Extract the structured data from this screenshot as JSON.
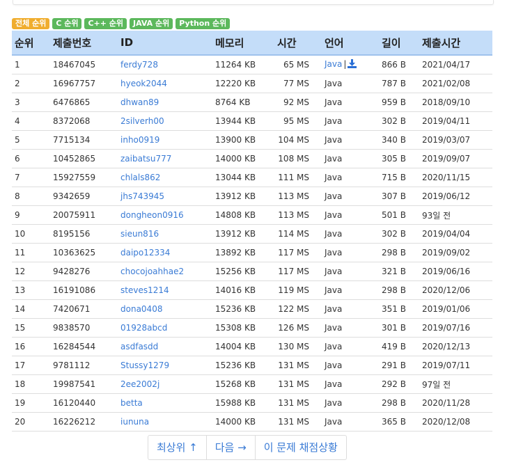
{
  "filters": [
    {
      "label": "전체 순위",
      "color": "#f0ad2e"
    },
    {
      "label": "C 순위",
      "color": "#5cb85c"
    },
    {
      "label": "C++ 순위",
      "color": "#5cb85c"
    },
    {
      "label": "JAVA 순위",
      "color": "#5cb85c"
    },
    {
      "label": "Python 순위",
      "color": "#5cb85c"
    }
  ],
  "table": {
    "headers": [
      "순위",
      "제출번호",
      "ID",
      "메모리",
      "시간",
      "언어",
      "길이",
      "제출시간"
    ],
    "rows": [
      {
        "rank": "1",
        "submission": "18467045",
        "id": "ferdy728",
        "memory": "11264 KB",
        "time": "65 MS",
        "lang": "Java",
        "length": "866 B",
        "submitted": "2021/04/17",
        "download": true
      },
      {
        "rank": "2",
        "submission": "16967757",
        "id": "hyeok2044",
        "memory": "12220 KB",
        "time": "77 MS",
        "lang": "Java",
        "length": "787 B",
        "submitted": "2021/02/08"
      },
      {
        "rank": "3",
        "submission": "6476865",
        "id": "dhwan89",
        "memory": "8764 KB",
        "time": "92 MS",
        "lang": "Java",
        "length": "959 B",
        "submitted": "2018/09/10"
      },
      {
        "rank": "4",
        "submission": "8372068",
        "id": "2silverh00",
        "memory": "13944 KB",
        "time": "95 MS",
        "lang": "Java",
        "length": "302 B",
        "submitted": "2019/04/11"
      },
      {
        "rank": "5",
        "submission": "7715134",
        "id": "inho0919",
        "memory": "13900 KB",
        "time": "104 MS",
        "lang": "Java",
        "length": "340 B",
        "submitted": "2019/03/07"
      },
      {
        "rank": "6",
        "submission": "10452865",
        "id": "zaibatsu777",
        "memory": "14000 KB",
        "time": "108 MS",
        "lang": "Java",
        "length": "305 B",
        "submitted": "2019/09/07"
      },
      {
        "rank": "7",
        "submission": "15927559",
        "id": "chlals862",
        "memory": "13044 KB",
        "time": "111 MS",
        "lang": "Java",
        "length": "715 B",
        "submitted": "2020/11/15"
      },
      {
        "rank": "8",
        "submission": "9342659",
        "id": "jhs743945",
        "memory": "13912 KB",
        "time": "113 MS",
        "lang": "Java",
        "length": "307 B",
        "submitted": "2019/06/12"
      },
      {
        "rank": "9",
        "submission": "20075911",
        "id": "dongheon0916",
        "memory": "14808 KB",
        "time": "113 MS",
        "lang": "Java",
        "length": "501 B",
        "submitted": "93일 전"
      },
      {
        "rank": "10",
        "submission": "8195156",
        "id": "sieun816",
        "memory": "13912 KB",
        "time": "114 MS",
        "lang": "Java",
        "length": "302 B",
        "submitted": "2019/04/04"
      },
      {
        "rank": "11",
        "submission": "10363625",
        "id": "daipo12334",
        "memory": "13892 KB",
        "time": "117 MS",
        "lang": "Java",
        "length": "298 B",
        "submitted": "2019/09/02"
      },
      {
        "rank": "12",
        "submission": "9428276",
        "id": "chocojoahhae2",
        "memory": "15256 KB",
        "time": "117 MS",
        "lang": "Java",
        "length": "321 B",
        "submitted": "2019/06/16"
      },
      {
        "rank": "13",
        "submission": "16191086",
        "id": "steves1214",
        "memory": "14016 KB",
        "time": "119 MS",
        "lang": "Java",
        "length": "298 B",
        "submitted": "2020/12/06"
      },
      {
        "rank": "14",
        "submission": "7420671",
        "id": "dona0408",
        "memory": "15236 KB",
        "time": "122 MS",
        "lang": "Java",
        "length": "351 B",
        "submitted": "2019/01/06"
      },
      {
        "rank": "15",
        "submission": "9838570",
        "id": "01928abcd",
        "memory": "15308 KB",
        "time": "126 MS",
        "lang": "Java",
        "length": "301 B",
        "submitted": "2019/07/16"
      },
      {
        "rank": "16",
        "submission": "16284544",
        "id": "asdfasdd",
        "memory": "14004 KB",
        "time": "130 MS",
        "lang": "Java",
        "length": "419 B",
        "submitted": "2020/12/13"
      },
      {
        "rank": "17",
        "submission": "9781112",
        "id": "Stussy1279",
        "memory": "15236 KB",
        "time": "131 MS",
        "lang": "Java",
        "length": "291 B",
        "submitted": "2019/07/11"
      },
      {
        "rank": "18",
        "submission": "19987541",
        "id": "2ee2002j",
        "memory": "15268 KB",
        "time": "131 MS",
        "lang": "Java",
        "length": "292 B",
        "submitted": "97일 전"
      },
      {
        "rank": "19",
        "submission": "16120440",
        "id": "betta",
        "memory": "15988 KB",
        "time": "131 MS",
        "lang": "Java",
        "length": "298 B",
        "submitted": "2020/11/28"
      },
      {
        "rank": "20",
        "submission": "16226212",
        "id": "iununa",
        "memory": "14000 KB",
        "time": "131 MS",
        "lang": "Java",
        "length": "365 B",
        "submitted": "2020/12/08"
      }
    ]
  },
  "pagination": {
    "top_label": "최상위 ↑",
    "next_label": "다음 →",
    "status_label": "이 문제 채점상황"
  },
  "colors": {
    "header_bg": "#c4ddf9",
    "link": "#3a7bd5",
    "download_icon": "#2a6fd6"
  }
}
